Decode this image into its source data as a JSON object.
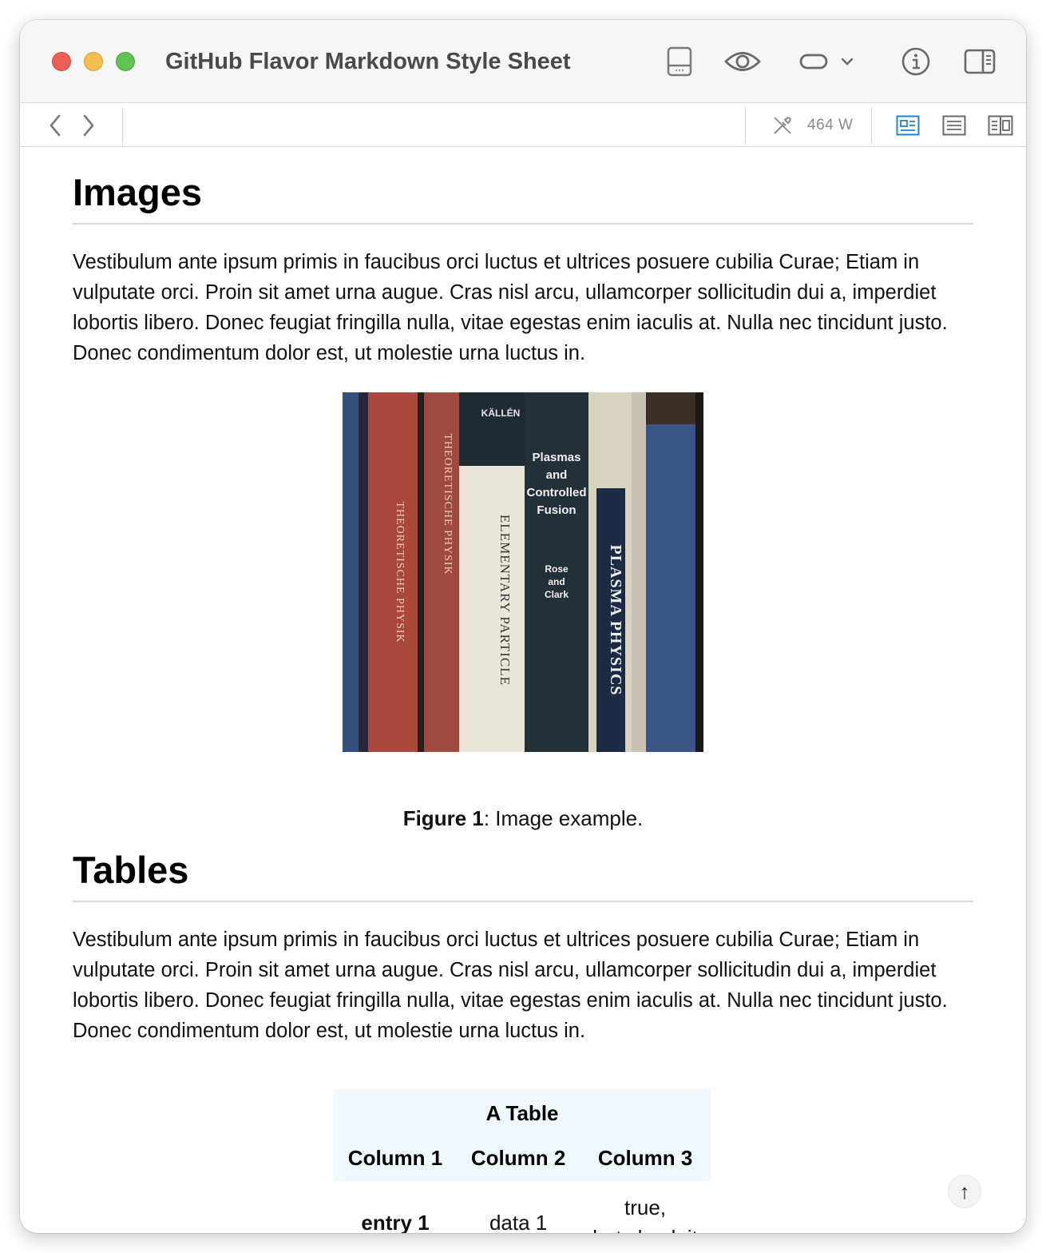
{
  "window": {
    "title": "GitHub Flavor Markdown Style Sheet",
    "icons": [
      "sidebar-toggle-icon",
      "eye-icon",
      "pill-toggle-icon",
      "chevron-down-icon",
      "info-icon",
      "inspector-panel-icon"
    ]
  },
  "toolbar": {
    "back_icon": "chevron-left-icon",
    "forward_icon": "chevron-right-icon",
    "word_count": "464 W",
    "view_modes": [
      "preview-mode-icon",
      "text-mode-icon",
      "split-mode-icon"
    ],
    "active_view_mode": "preview-mode-icon",
    "accent_color": "#1a85d8"
  },
  "content": {
    "images_section": {
      "heading": "Images",
      "paragraph": "Vestibulum ante ipsum primis in faucibus orci luctus et ultrices posuere cubilia Curae; Etiam in vulputate orci. Proin sit amet urna augue. Cras nisl arcu, ullamcorper sollicitudin dui a, imperdiet lobortis libero. Donec feugiat fringilla nulla, vitae egestas enim iaculis at. Nulla nec tincidunt justo. Donec condimentum dolor est, ut molestie urna luctus in.",
      "figure": {
        "book_spines": [
          {
            "text": "THEORETISCHE PHYSIK",
            "color": "#a8473c"
          },
          {
            "text": "THEORETISCHE PHYSIK",
            "color": "#9f4a3e"
          },
          {
            "text": "KÄLLÉN",
            "color": "#1f2b33"
          },
          {
            "text": "ELEMENTARY PARTICLE",
            "color": "#ebe6da"
          },
          {
            "text": "Plasmas and Controlled Fusion",
            "color": "#243038"
          },
          {
            "text": "Rose and Clark",
            "color": "#243038"
          },
          {
            "text": "PLASMA PHYSICS",
            "color": "#d8d2c0"
          }
        ],
        "caption_label": "Figure 1",
        "caption_text": ": Image example."
      }
    },
    "tables_section": {
      "heading": "Tables",
      "paragraph": "Vestibulum ante ipsum primis in faucibus orci luctus et ultrices posuere cubilia Curae; Etiam in vulputate orci. Proin sit amet urna augue. Cras nisl arcu, ullamcorper sollicitudin dui a, imperdiet lobortis libero. Donec feugiat fringilla nulla, vitae egestas enim iaculis at. Nulla nec tincidunt justo. Donec condimentum dolor est, ut molestie urna luctus in.",
      "table": {
        "caption": "A Table",
        "columns": [
          "Column 1",
          "Column 2",
          "Column 3"
        ],
        "rows": [
          {
            "c1": "entry 1",
            "c2": "data 1",
            "c3_line1": "true,",
            "c3_line2": "but check it"
          }
        ],
        "header_bg": "#eff8fd"
      }
    },
    "scroll_top_label": "↑"
  }
}
